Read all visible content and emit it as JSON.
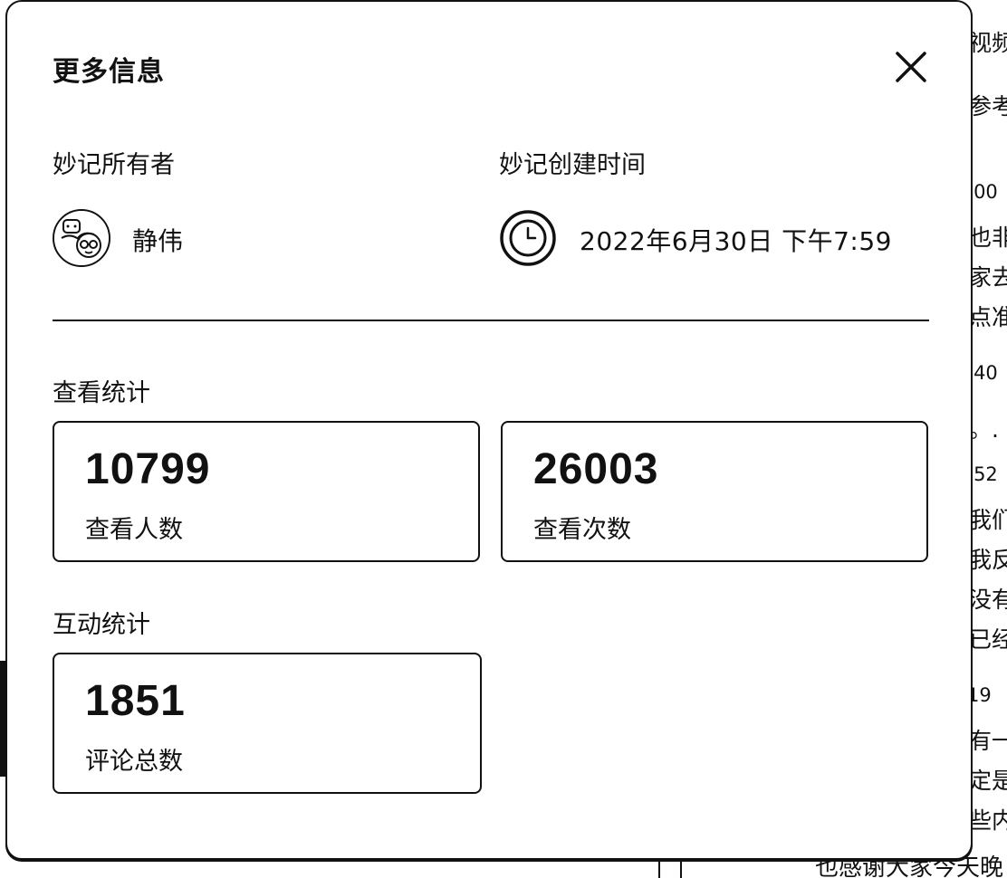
{
  "modal": {
    "title": "更多信息",
    "owner_label": "妙记所有者",
    "owner_name": "静伟",
    "created_label": "妙记创建时间",
    "created_time": "2022年6月30日 下午7:59",
    "view_stats_title": "查看统计",
    "interaction_stats_title": "互动统计",
    "view_stats": [
      {
        "value": "10799",
        "label": "查看人数"
      },
      {
        "value": "26003",
        "label": "查看次数"
      }
    ],
    "interaction_stats": [
      {
        "value": "1851",
        "label": "评论总数"
      }
    ]
  },
  "background": {
    "right_lines": [
      "视频",
      "参考",
      ":00",
      "也非",
      "家去",
      "点准",
      ":40",
      "。.",
      ":52",
      "我们",
      "我反",
      "没有",
      "已经",
      "19",
      "有一",
      "定是",
      "些内"
    ],
    "bottom_line": "也感谢大家今天晚"
  },
  "icons": {
    "close": "close-icon",
    "clock": "clock-icon",
    "avatar": "avatar-cartoon-image"
  },
  "colors": {
    "text": "#111111",
    "background": "#ffffff",
    "border": "#111111"
  }
}
